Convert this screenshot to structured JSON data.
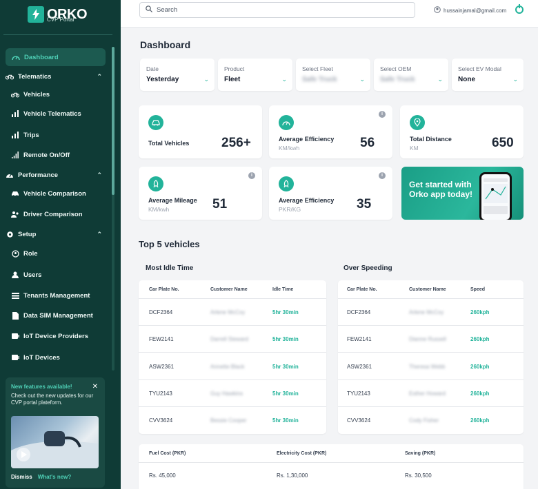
{
  "brand": {
    "name": "ORKO",
    "sub": "CVP Portal"
  },
  "colors": {
    "sidebar": "#0f3b36",
    "accent": "#22b39a"
  },
  "nav": {
    "dashboard": "Dashboard",
    "telematics": "Telematics",
    "vehicles": "Vehicles",
    "vehicle_telematics": "Vehicle Telematics",
    "trips": "Trips",
    "remote": "Remote On/Off",
    "performance": "Performance",
    "vehicle_comparison": "Vehicle Comparison",
    "driver_comparison": "Driver Comparison",
    "setup": "Setup",
    "role": "Role",
    "users": "Users",
    "tenants": "Tenants Management",
    "data_sim": "Data SIM Management",
    "iot_providers": "IoT Device Providers",
    "iot_devices": "IoT Devices"
  },
  "promo": {
    "title": "New features available!",
    "text": "Check out the new updates for our CVP portal plateform.",
    "dismiss": "Dismiss",
    "whats_new": "What's new?"
  },
  "topbar": {
    "search_placeholder": "Search",
    "email": "hussainjamal@gmail.com"
  },
  "page_title": "Dashboard",
  "filters": [
    {
      "label": "Date",
      "value": "Yesterday"
    },
    {
      "label": "Product",
      "value": "Fleet"
    },
    {
      "label": "Select Fleet",
      "value": "Safe Truck"
    },
    {
      "label": "Select OEM",
      "value": "Safe Truck"
    },
    {
      "label": "Select EV Modal",
      "value": "None"
    }
  ],
  "stats": {
    "total_vehicles": {
      "title": "Total Vehicles",
      "value": "256+"
    },
    "avg_eff_km": {
      "title": "Average Efficiency",
      "unit": "KM/kwh",
      "value": "56"
    },
    "total_distance": {
      "title": "Total Distance",
      "unit": "KM",
      "value": "650"
    },
    "avg_mileage": {
      "title": "Average Mileage",
      "unit": "KM/kwh",
      "value": "51"
    },
    "avg_eff_pkr": {
      "title": "Average Efficiency",
      "unit": "PKR/KG",
      "value": "35"
    }
  },
  "app_promo": {
    "text": "Get started with Orko app today!"
  },
  "top5": {
    "title": "Top 5 vehicles",
    "idle": {
      "title": "Most Idle Time",
      "headers": [
        "Car Plate No.",
        "Customer Name",
        "Idle Time"
      ],
      "rows": [
        [
          "DCF2364",
          "Arlene McCoy",
          "5hr 30min"
        ],
        [
          "FEW2141",
          "Darrell Steward",
          "5hr 30min"
        ],
        [
          "ASW2361",
          "Annette Black",
          "5hr 30min"
        ],
        [
          "TYU2143",
          "Guy Hawkins",
          "5hr 30min"
        ],
        [
          "CVV3624",
          "Bessie Cooper",
          "5hr 30min"
        ]
      ]
    },
    "speed": {
      "title": "Over Speeding",
      "headers": [
        "Car Plate No.",
        "Customer Name",
        "Speed"
      ],
      "rows": [
        [
          "DCF2364",
          "Arlene McCoy",
          "260kph"
        ],
        [
          "FEW2141",
          "Dianne Russell",
          "260kph"
        ],
        [
          "ASW2361",
          "Theresa Webb",
          "260kph"
        ],
        [
          "TYU2143",
          "Esther Howard",
          "260kph"
        ],
        [
          "CVV3624",
          "Cody Fisher",
          "260kph"
        ]
      ]
    }
  },
  "costs": {
    "headers": [
      "Fuel Cost (PKR)",
      "Electricity Cost (PKR)",
      "Saving (PKR)"
    ],
    "values": [
      "Rs. 45,000",
      "Rs. 1,30,000",
      "Rs. 30,500"
    ]
  }
}
